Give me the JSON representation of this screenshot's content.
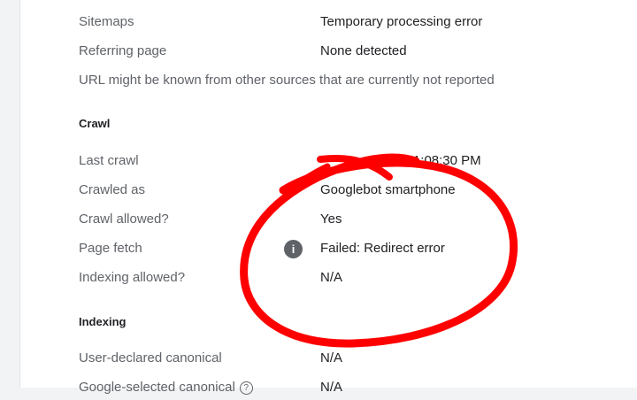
{
  "rows_top": [
    {
      "label": "Sitemaps",
      "value": "Temporary processing error"
    },
    {
      "label": "Referring page",
      "value": "None detected"
    }
  ],
  "discovery_note": "URL might be known from other sources that are currently not reported",
  "crawl": {
    "heading": "Crawl",
    "last_crawl_label": "Last crawl",
    "last_crawl_value": "2024, 11:08:30 PM",
    "crawled_as_label": "Crawled as",
    "crawled_as_value": "Googlebot smartphone",
    "crawl_allowed_label": "Crawl allowed?",
    "crawl_allowed_value": "Yes",
    "page_fetch_label": "Page fetch",
    "page_fetch_icon": "info-icon",
    "page_fetch_value": "Failed: Redirect error",
    "indexing_allowed_label": "Indexing allowed?",
    "indexing_allowed_value": "N/A"
  },
  "indexing": {
    "heading": "Indexing",
    "user_canonical_label": "User-declared canonical",
    "user_canonical_value": "N/A",
    "google_canonical_label": "Google-selected canonical",
    "google_canonical_icon": "help-icon",
    "google_canonical_value": "N/A"
  },
  "colors": {
    "annotation": "#ff0000",
    "label_text": "#5f6368",
    "value_text": "#202124"
  }
}
